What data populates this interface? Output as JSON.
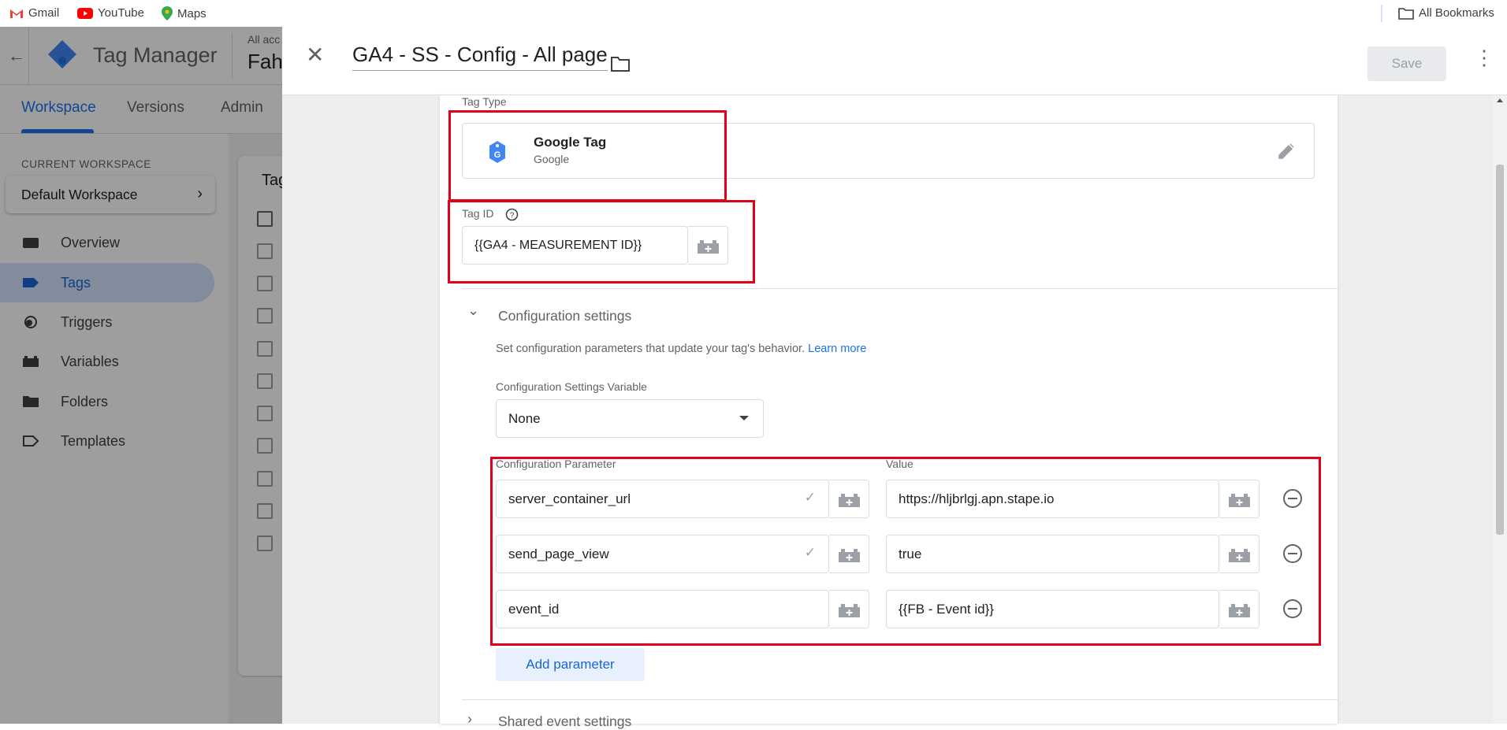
{
  "bookmarks": {
    "items": [
      {
        "label": "Gmail",
        "icon": "gmail-icon"
      },
      {
        "label": "YouTube",
        "icon": "youtube-icon"
      },
      {
        "label": "Maps",
        "icon": "maps-icon"
      }
    ],
    "all_bookmarks": "All Bookmarks"
  },
  "header": {
    "app_title": "Tag Manager",
    "account_crumb": "All acc",
    "container_name": "Fah"
  },
  "nav": {
    "tabs": [
      "Workspace",
      "Versions",
      "Admin"
    ]
  },
  "sidebar": {
    "current_workspace_label": "CURRENT WORKSPACE",
    "workspace_name": "Default Workspace",
    "items": [
      {
        "label": "Overview",
        "icon": "overview-icon"
      },
      {
        "label": "Tags",
        "icon": "tag-icon"
      },
      {
        "label": "Triggers",
        "icon": "trigger-icon"
      },
      {
        "label": "Variables",
        "icon": "variables-icon"
      },
      {
        "label": "Folders",
        "icon": "folder-icon"
      },
      {
        "label": "Templates",
        "icon": "template-icon"
      }
    ]
  },
  "list": {
    "header_fragment": "Tag"
  },
  "panel": {
    "title": "GA4 - SS - Config - All page",
    "save_label": "Save",
    "tag_type_label": "Tag Type",
    "tag_type_name": "Google Tag",
    "tag_type_vendor": "Google",
    "tag_id_label": "Tag ID",
    "tag_id_value": "{{GA4 - MEASUREMENT ID}}",
    "config_section_title": "Configuration settings",
    "config_description": "Set configuration parameters that update your tag's behavior.",
    "learn_more": "Learn more",
    "config_var_label": "Configuration Settings Variable",
    "config_var_value": "None",
    "param_col_label": "Configuration Parameter",
    "value_col_label": "Value",
    "params": [
      {
        "name": "server_container_url",
        "value": "https://hljbrlgj.apn.stape.io",
        "checked": true
      },
      {
        "name": "send_page_view",
        "value": "true",
        "checked": true
      },
      {
        "name": "event_id",
        "value": "{{FB - Event id}}",
        "checked": false
      }
    ],
    "add_parameter_label": "Add parameter",
    "next_section_fragment": "Shared event settings"
  },
  "colors": {
    "accent": "#1a73e8",
    "highlight_red": "#e0001b"
  }
}
